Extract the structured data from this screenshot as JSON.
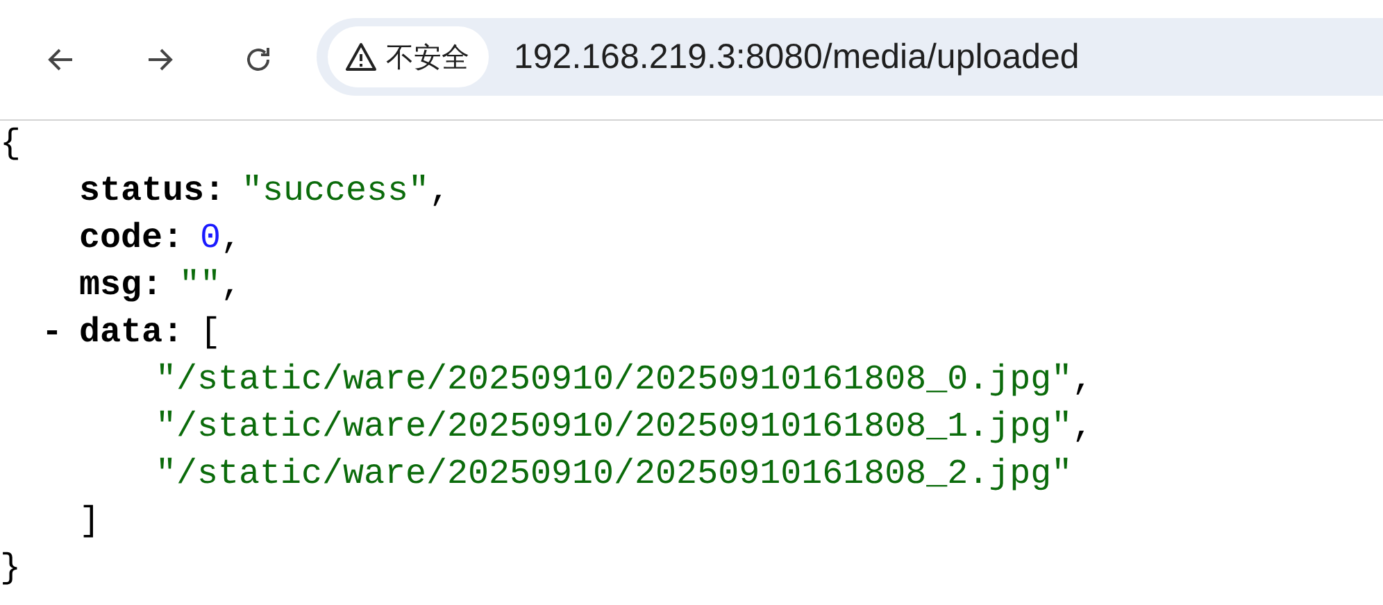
{
  "browser": {
    "security_label": "不安全",
    "url": "192.168.219.3:8080/media/uploaded"
  },
  "json_view": {
    "open": "{",
    "close": "}",
    "entries": [
      {
        "key": "status:",
        "kind": "string",
        "value": "\"success\"",
        "trailer": ","
      },
      {
        "key": "code:",
        "kind": "number",
        "value": "0",
        "trailer": ","
      },
      {
        "key": "msg:",
        "kind": "string",
        "value": "\"\"",
        "trailer": ","
      },
      {
        "key": "data:",
        "kind": "array",
        "toggle": "-",
        "expanded": true,
        "open": "[",
        "close": "]",
        "items": [
          {
            "value": "\"/static/ware/20250910/20250910161808_0.jpg\"",
            "trailer": ","
          },
          {
            "value": "\"/static/ware/20250910/20250910161808_1.jpg\"",
            "trailer": ","
          },
          {
            "value": "\"/static/ware/20250910/20250910161808_2.jpg\""
          }
        ]
      }
    ]
  }
}
